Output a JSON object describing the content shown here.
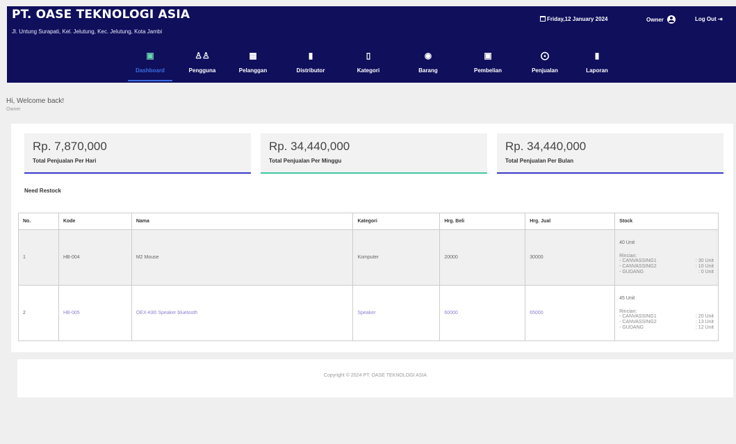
{
  "header": {
    "brand": "PT. OASE TEKNOLOGI ASIA",
    "address": "Jl. Untung Surapati, Kel. Jelutung, Kec. Jelutung, Kota Jambi",
    "date": "Friday,12 January 2024",
    "user": "Owner",
    "logout": "Log Out"
  },
  "nav": [
    {
      "label": "Dashboard",
      "icon": "dashboard-icon",
      "active": true
    },
    {
      "label": "Pengguna",
      "icon": "users-icon"
    },
    {
      "label": "Pelanggan",
      "icon": "customer-card-icon"
    },
    {
      "label": "Distributor",
      "icon": "distributor-icon"
    },
    {
      "label": "Kategori",
      "icon": "bookmark-icon"
    },
    {
      "label": "Barang",
      "icon": "product-icon"
    },
    {
      "label": "Pembelian",
      "icon": "money-icon"
    },
    {
      "label": "Penjualan",
      "icon": "cart-icon"
    },
    {
      "label": "Laporan",
      "icon": "report-icon"
    }
  ],
  "welcome": {
    "greeting": "Hi, Welcome back!",
    "role": "Owner"
  },
  "stats": [
    {
      "amount": "Rp. 7,870,000",
      "caption": "Total Penjualan Per Hari",
      "accent": "#3a3ad0"
    },
    {
      "amount": "Rp. 34,440,000",
      "caption": "Total Penjualan Per Minggu",
      "accent": "#40c9a2"
    },
    {
      "amount": "Rp. 34,440,000",
      "caption": "Total Penjualan Per Bulan",
      "accent": "#3a3ad0"
    }
  ],
  "restock": {
    "title": "Need Restock",
    "headers": [
      "No.",
      "Kode",
      "Nama",
      "Kategori",
      "Hrg. Beli",
      "Hrg. Jual",
      "Stock"
    ],
    "rows": [
      {
        "no": "1",
        "kode": "HB-004",
        "nama": "M2 Mouse",
        "kategori": "Komputer",
        "beli": "20000",
        "jual": "30000",
        "stock_total": "40 Unit",
        "rincian_label": "Rincian:",
        "rincian": [
          {
            "loc": "- CANVASSING1",
            "qty": ": 30 Unit"
          },
          {
            "loc": "- CANVASSING2",
            "qty": ": 10 Unit"
          },
          {
            "loc": "- GUDANG",
            "qty": ": 0 Unit"
          }
        ]
      },
      {
        "no": "2",
        "kode": "HB-005",
        "nama": "OEX-K80 Speaker bluetooth",
        "kategori": "Speaker",
        "beli": "60000",
        "jual": "65000",
        "stock_total": "45 Unit",
        "rincian_label": "Rincian:",
        "rincian": [
          {
            "loc": "- CANVASSING1",
            "qty": ": 20 Unit"
          },
          {
            "loc": "- CANVASSING2",
            "qty": ": 13 Unit"
          },
          {
            "loc": "- GUDANG",
            "qty": ": 12 Unit"
          }
        ]
      }
    ]
  },
  "footer": {
    "copyright": "Copyright © 2024 PT. OASE TEKNOLOGI ASIA"
  }
}
